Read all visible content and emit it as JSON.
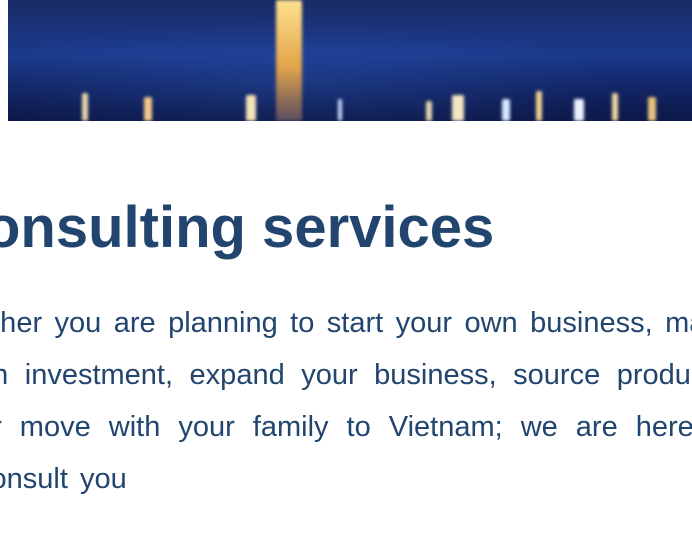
{
  "hero": {
    "image": "city-night-waterfront-reflection",
    "colors": [
      "#1b3a8c",
      "#0f1d52"
    ]
  },
  "section": {
    "heading": "onsulting services",
    "paragraph": "ether you are planning to start your own business, make an investment, expand your business, source products, or move with your family to Vietnam; we are here to consult you"
  },
  "colors": {
    "text": "#22456f",
    "background": "#ffffff"
  }
}
